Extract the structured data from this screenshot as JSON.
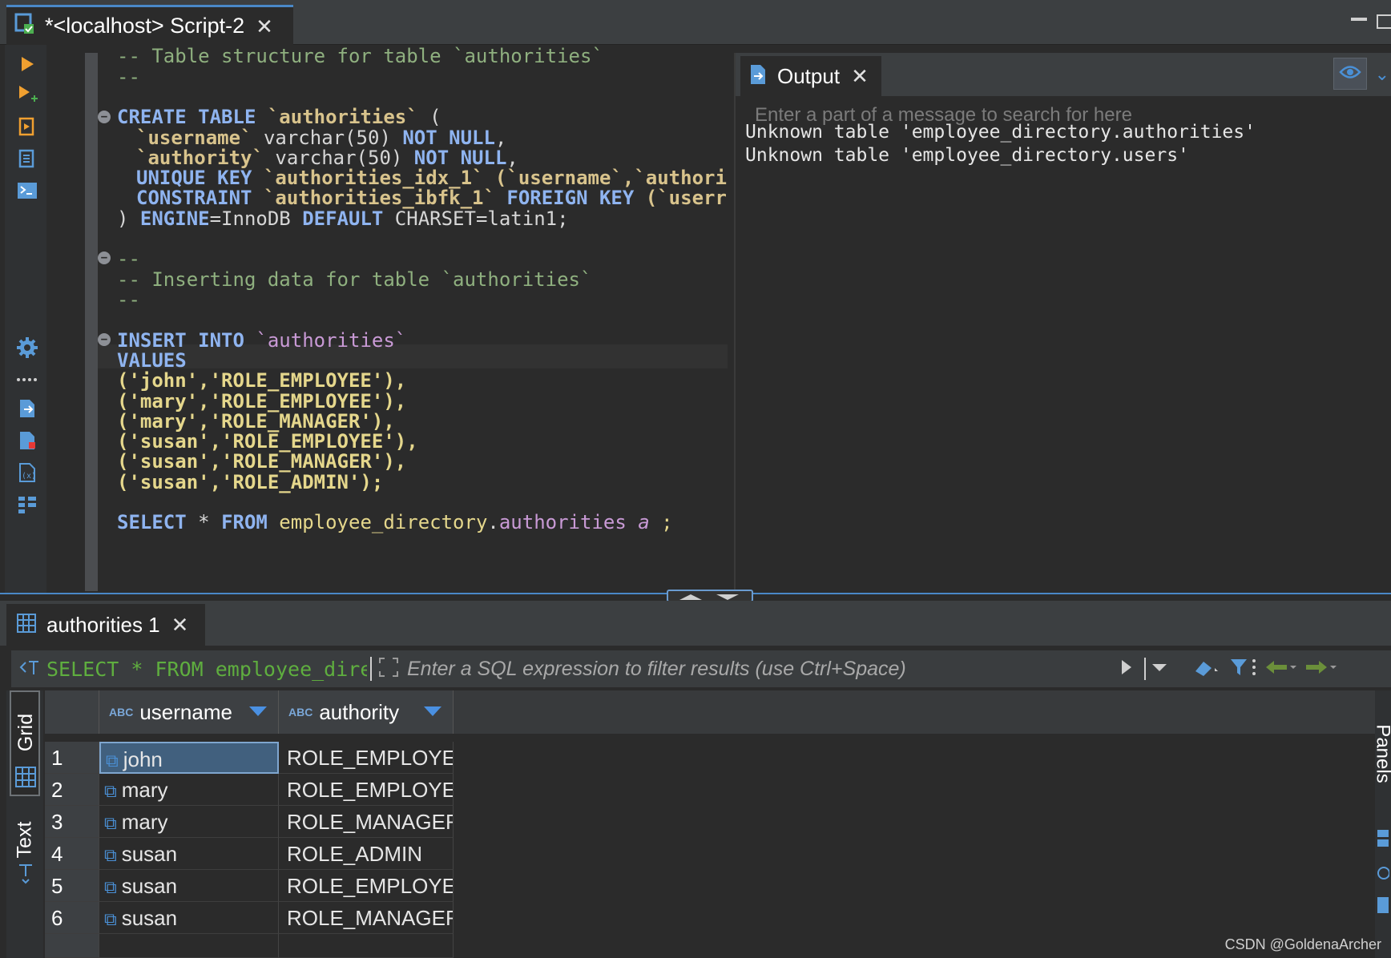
{
  "window": {
    "tab_title": "*<localhost> Script-2"
  },
  "editor": {
    "lines": {
      "l1_comment": "-- Table structure for table `authorities`",
      "l2_comment": "--",
      "l3_kw1": "CREATE TABLE",
      "l3_id": "`authorities`",
      "l3_rest": " (",
      "l4_id": "`username`",
      "l4_type": " varchar(50) ",
      "l4_kw": "NOT NULL",
      "l4_rest": ",",
      "l5_id": "`authority`",
      "l5_type": " varchar(50) ",
      "l5_kw": "NOT NULL",
      "l5_rest": ",",
      "l6_kw": "UNIQUE KEY",
      "l6_id": " `authorities_idx_1`",
      "l6_rest": " (`username`,`authori",
      "l7_kw": "CONSTRAINT",
      "l7_id": " `authorities_ibfk_1`",
      "l7_kw2": " FOREIGN KEY",
      "l7_rest": " (`userr",
      "l8_a": ") ",
      "l8_kw": "ENGINE",
      "l8_b": "=InnoDB ",
      "l8_kw2": "DEFAULT",
      "l8_c": " CHARSET=latin1;",
      "l9_comment": "--",
      "l10_comment": "-- Inserting data for table `authorities`",
      "l11_comment": "--",
      "l12_kw": "INSERT INTO",
      "l12_tb": " `authorities`",
      "l13_kw": "VALUES",
      "l14": "('john','ROLE_EMPLOYEE'),",
      "l15": "('mary','ROLE_EMPLOYEE'),",
      "l16": "('mary','ROLE_MANAGER'),",
      "l17": "('susan','ROLE_EMPLOYEE'),",
      "l18": "('susan','ROLE_MANAGER'),",
      "l19": "('susan','ROLE_ADMIN');",
      "l20_kw": "SELECT",
      "l20_star": " * ",
      "l20_kw2": "FROM",
      "l20_schema": " employee_directory",
      "l20_dot": ".",
      "l20_tb": "authorities",
      "l20_alias": " a ",
      "l20_end": ";"
    }
  },
  "output": {
    "tab_title": "Output",
    "search_placeholder": "Enter a part of a message to search for here",
    "messages": [
      "Unknown table 'employee_directory.authorities'",
      "Unknown table 'employee_directory.users'"
    ]
  },
  "results": {
    "tab_title": "authorities 1",
    "filter_query": "SELECT * FROM employee_dire",
    "filter_placeholder": "Enter a SQL expression to filter results (use Ctrl+Space)",
    "side_tabs": {
      "grid": "Grid",
      "text": "Text"
    },
    "right_panel_label": "Panels",
    "columns": [
      {
        "type_badge": "ABC",
        "name": "username"
      },
      {
        "type_badge": "ABC",
        "name": "authority"
      }
    ],
    "rows": [
      {
        "num": "1",
        "username": "john",
        "authority": "ROLE_EMPLOYEE"
      },
      {
        "num": "2",
        "username": "mary",
        "authority": "ROLE_EMPLOYEE"
      },
      {
        "num": "3",
        "username": "mary",
        "authority": "ROLE_MANAGER"
      },
      {
        "num": "4",
        "username": "susan",
        "authority": "ROLE_ADMIN"
      },
      {
        "num": "5",
        "username": "susan",
        "authority": "ROLE_EMPLOYEE"
      },
      {
        "num": "6",
        "username": "susan",
        "authority": "ROLE_MANAGER"
      }
    ]
  },
  "watermark": "CSDN @GoldenaArcher",
  "colors": {
    "accent": "#4a88c7",
    "keyword": "#8fb4f0",
    "comment": "#8fb07f",
    "string": "#e5d78c",
    "table_name": "#c99ad6",
    "filter_text": "#5fae3f"
  }
}
